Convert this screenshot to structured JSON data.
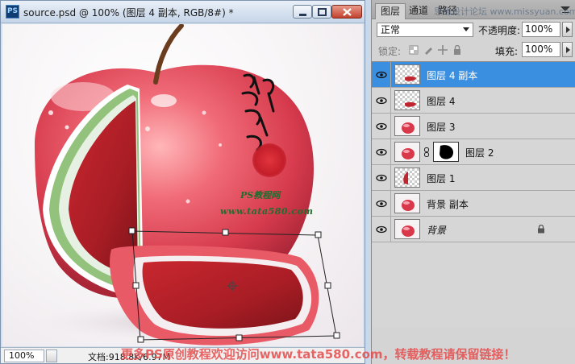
{
  "document": {
    "title": "source.psd @ 100% (图层 4 副本, RGB/8#) *",
    "app_icon": "PS",
    "zoom": "100%",
    "doc_size": "文档:918.8K/6.97M",
    "watermark": {
      "site_name": "PS教程网",
      "url": "www.tata580.com"
    }
  },
  "layers_panel": {
    "tabs": [
      "图层",
      "通道",
      "路径"
    ],
    "blend_mode": "正常",
    "opacity_label": "不透明度:",
    "opacity_value": "100%",
    "lock_label": "锁定:",
    "fill_label": "填充:",
    "fill_value": "100%",
    "layers": [
      {
        "name": "图层 4 副本",
        "selected": true,
        "visible": true,
        "thumb": "transparent-slice"
      },
      {
        "name": "图层 4",
        "selected": false,
        "visible": true,
        "thumb": "transparent-slice"
      },
      {
        "name": "图层 3",
        "selected": false,
        "visible": true,
        "thumb": "apple"
      },
      {
        "name": "图层 2",
        "selected": false,
        "visible": true,
        "thumb": "apple-with-mask"
      },
      {
        "name": "图层 1",
        "selected": false,
        "visible": true,
        "thumb": "transparent-slice-side"
      },
      {
        "name": "背景 副本",
        "selected": false,
        "visible": true,
        "thumb": "apple"
      },
      {
        "name": "背景",
        "selected": false,
        "visible": true,
        "thumb": "apple",
        "locked": true
      }
    ]
  },
  "overlay_watermarks": {
    "top": "思缘设计论坛 www.missyuan.com",
    "bottom": "更多PS原创教程欢迎访问www.tata580.com，转载教程请保留链接！"
  }
}
